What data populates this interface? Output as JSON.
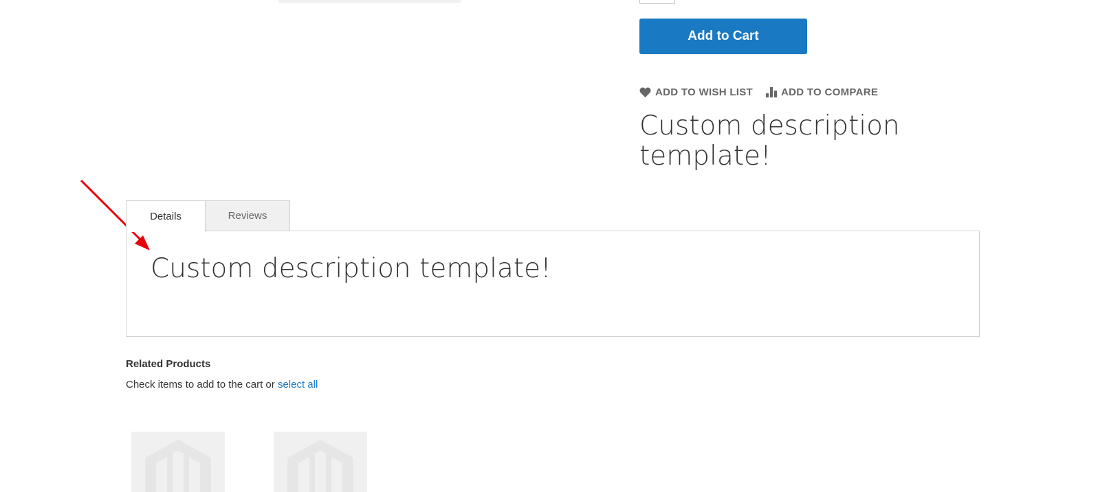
{
  "product": {
    "add_to_cart_label": "Add to Cart",
    "wishlist_label": "ADD TO WISH LIST",
    "compare_label": "ADD TO COMPARE",
    "short_description": "Custom description template!"
  },
  "tabs": [
    {
      "label": "Details",
      "active": true
    },
    {
      "label": "Reviews",
      "active": false
    }
  ],
  "details_content": "Custom description template!",
  "related": {
    "title": "Related Products",
    "info_prefix": "Check items to add to the cart or",
    "select_all_label": "select all",
    "thumbnails": [
      "placeholder-image",
      "placeholder-image"
    ]
  },
  "colors": {
    "primary": "#1979c3",
    "annotation": "#e8000b",
    "tab_inactive_bg": "#f0f0f0"
  },
  "icons": [
    "heart-icon",
    "compare-icon",
    "magento-logo-icon",
    "annotation-arrow"
  ]
}
